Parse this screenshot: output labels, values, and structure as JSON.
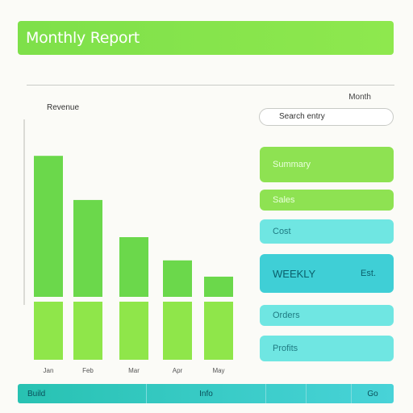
{
  "header": {
    "title": "Monthly Report"
  },
  "top_right_label": "Month",
  "chart": {
    "label": "Revenue"
  },
  "search": {
    "value": "Search entry"
  },
  "panels": [
    {
      "label": "Summary",
      "value": ""
    },
    {
      "label": "Sales",
      "value": ""
    },
    {
      "label": "Cost",
      "value": ""
    },
    {
      "label": "WEEKLY",
      "value": "Est."
    },
    {
      "label": "Orders",
      "value": ""
    },
    {
      "label": "Profits",
      "value": ""
    }
  ],
  "status_bar": {
    "left": "Build",
    "mid": "Info",
    "right": "Go"
  },
  "colors": {
    "accent_green": "#8ee252",
    "accent_cyan": "#6fe6e2",
    "accent_teal": "#3fcfd6"
  },
  "chart_data": {
    "type": "bar",
    "categories": [
      "Jan",
      "Feb",
      "Mar",
      "Apr",
      "May"
    ],
    "values": [
      85,
      66,
      50,
      40,
      33
    ],
    "ylim": [
      0,
      100
    ],
    "grid": false,
    "title": "",
    "xlabel": "",
    "ylabel": ""
  }
}
